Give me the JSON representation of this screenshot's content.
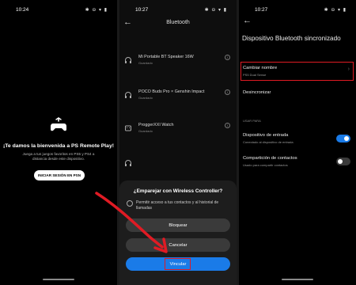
{
  "screen1": {
    "status_time": "10:24",
    "status_icons": "✱ ⊖ ▾ ▮",
    "welcome_title": "¡Te damos la bienvenida a PS Remote Play!",
    "welcome_subtitle": "Juega a tus juegos favoritos en PS5 y PS4 a distancia desde este dispositivo.",
    "signin_button": "INICIAR SESIÓN EN PSN"
  },
  "screen2": {
    "status_time": "10:27",
    "status_icons": "✱ ⊖ ▾ ▮",
    "back_label": "←",
    "title": "Bluetooth",
    "devices": [
      {
        "name": "Mi Portable BT Speaker 16W",
        "status": "Guardado",
        "icon": "headphones-icon"
      },
      {
        "name": "POCO Buds Pro × Genshin Impact",
        "status": "Guardado",
        "icon": "headphones-icon"
      },
      {
        "name": "ProggerXXI Watch",
        "status": "Guardado",
        "icon": "watch-icon"
      },
      {
        "name": "",
        "status": "",
        "icon": "headphones-icon"
      }
    ],
    "info_glyph": "i",
    "pair_dialog": {
      "title": "¿Emparejar con Wireless Controller?",
      "permission_text": "Permitir acceso a tus contactos y al historial de llamadas",
      "block_button": "Bloquear",
      "cancel_button": "Cancelar",
      "link_button": "Vincular"
    }
  },
  "screen3": {
    "status_time": "10:27",
    "status_icons": "✱ ⊖ ▾ ▮",
    "back_label": "←",
    "title": "Dispositivo Bluetooth sincronizado",
    "rename_label": "Cambiar nombre",
    "rename_sub": "PS5 Dual Sense",
    "chevron": "›",
    "unsync_label": "Desincronizar",
    "section_label": "USAR PARA",
    "input_device_label": "Dispositivo de entrada",
    "input_device_sub": "Conectado al dispositivo de entrada",
    "input_device_on": true,
    "contacts_label": "Compartición de contactos",
    "contacts_sub": "Usado para compartir contactos",
    "contacts_on": false
  },
  "colors": {
    "accent": "#1a7be8",
    "highlight_red": "#e01b24",
    "background": "#000000",
    "sheet": "#1d1d1d"
  }
}
